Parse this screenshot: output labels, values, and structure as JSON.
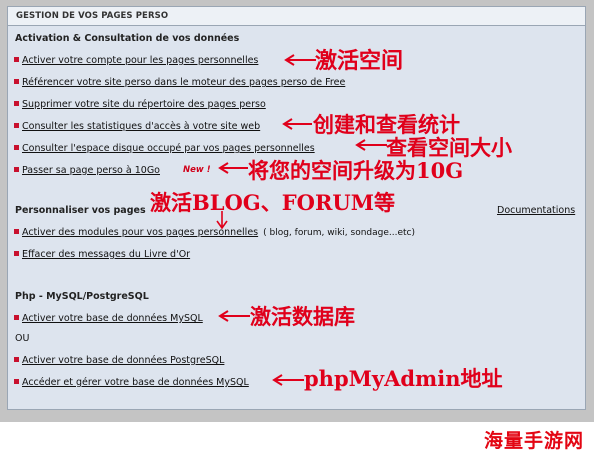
{
  "panel": {
    "title": "GESTION DE VOS PAGES PERSO"
  },
  "sections": {
    "activation": "Activation & Consultation de vos données",
    "personnaliser": "Personnaliser vos pages",
    "php": "Php - MySQL/PostgreSQL"
  },
  "items": {
    "activate_account": "Activer votre compte pour les pages personnelles",
    "reference_site": "Référencer votre site perso dans le moteur des pages perso de Free",
    "delete_site": "Supprimer votre site du répertoire des pages perso",
    "stats": "Consulter les statistiques d'accès à votre site web",
    "disk_space": "Consulter l'espace disque occupé par vos pages personnelles",
    "upgrade_10go": "Passer sa page perso à 10Go",
    "new_badge": "New !",
    "activate_modules": "Activer des modules pour vos pages personnelles",
    "modules_extra": "( blog, forum, wiki, sondage...etc)",
    "erase_guestbook": "Effacer des messages du Livre d'Or",
    "mysql": "Activer votre base de données MySQL",
    "or": "OU",
    "postgresql": "Activer votre base de données PostgreSQL",
    "manage_mysql": "Accéder et gérer votre base de données MySQL"
  },
  "documentations_link": "Documentations",
  "annotations": {
    "a1": "激活空间",
    "a2": "创建和查看统计",
    "a3": "查看空间大小",
    "a4": "将您的空间升级为10G",
    "a5": "激活BLOG、FORUM等",
    "a6": "激活数据库",
    "a7": "phpMyAdmin地址"
  },
  "watermark": "海量手游网",
  "colors": {
    "annotation": "#e0001b",
    "bullet": "#c8102e",
    "panel": "#dde4ee"
  }
}
